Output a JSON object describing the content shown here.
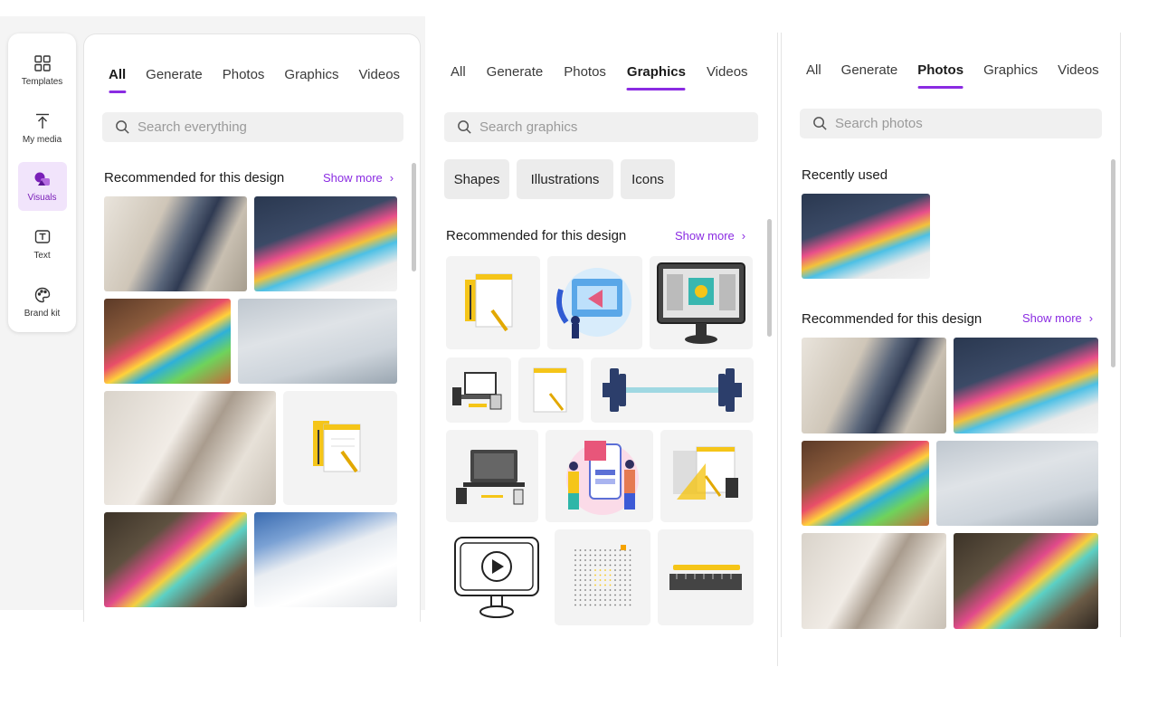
{
  "rail": [
    {
      "label": "Templates",
      "icon": "templates-icon",
      "active": false
    },
    {
      "label": "My media",
      "icon": "upload-icon",
      "active": false
    },
    {
      "label": "Visuals",
      "icon": "visuals-icon",
      "active": true
    },
    {
      "label": "Text",
      "icon": "text-icon",
      "active": false
    },
    {
      "label": "Brand kit",
      "icon": "palette-icon",
      "active": false
    }
  ],
  "tabs": [
    "All",
    "Generate",
    "Photos",
    "Graphics",
    "Videos"
  ],
  "panel_all": {
    "active_tab": "All",
    "search_placeholder": "Search everything",
    "section_title": "Recommended for this design",
    "show_more": "Show more"
  },
  "panel_graphics": {
    "active_tab": "Graphics",
    "search_placeholder": "Search graphics",
    "chips": [
      "Shapes",
      "Illustrations",
      "Icons"
    ],
    "section_title": "Recommended for this design",
    "show_more": "Show more"
  },
  "panel_photos": {
    "active_tab": "Photos",
    "search_placeholder": "Search photos",
    "recent_title": "Recently used",
    "section_title": "Recommended for this design",
    "show_more": "Show more"
  },
  "colors": {
    "accent": "#8a2be2",
    "rail_active_bg": "#f1e4fb",
    "search_bg": "#f0f0f0"
  }
}
